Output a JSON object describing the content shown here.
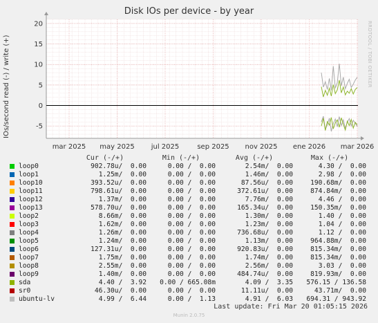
{
  "chart_data": {
    "type": "line",
    "title": "Disk IOs per device - by year",
    "ylabel": "IOs/second read (-) / write (+)",
    "ylim": [
      -8,
      21
    ],
    "y_ticks": [
      {
        "value": 20,
        "label": "20"
      },
      {
        "value": 15,
        "label": "15"
      },
      {
        "value": 10,
        "label": "10"
      },
      {
        "value": 5,
        "label": "5"
      },
      {
        "value": 0,
        "label": "0"
      },
      {
        "value": -5,
        "label": "-5"
      }
    ],
    "x_ticks": [
      "mar 2025",
      "may 2025",
      "jul 2025",
      "sep 2025",
      "nov 2025",
      "ene 2026",
      "mar 2026"
    ],
    "grid": true,
    "series": [
      {
        "name": "ubuntu-lv",
        "color": "#aaaaaa",
        "write": [
          8.0,
          4.5,
          5.8,
          3.9,
          6.6,
          3.7,
          9.6,
          4.2,
          5.6,
          10.2,
          4.8,
          6.9,
          4.1,
          5.4,
          6.4,
          4.4,
          5.2,
          6.2,
          6.9
        ],
        "read": [
          -4.0,
          -2.6,
          -5.8,
          -4.7,
          -3.1,
          -6.3,
          -4.4,
          -3.3,
          -5.2,
          -2.7,
          -4.9,
          -3.5,
          -5.6,
          -4.1,
          -3.2,
          -5.0,
          -3.6,
          -4.3,
          -5.1
        ]
      },
      {
        "name": "sda",
        "color": "#8fb62e",
        "write": [
          4.6,
          2.1,
          3.7,
          2.5,
          4.2,
          2.3,
          5.1,
          2.9,
          3.8,
          6.2,
          3.1,
          4.5,
          2.6,
          3.5,
          3.0,
          4.1,
          2.8,
          3.9,
          4.4
        ],
        "read": [
          -5.0,
          -3.1,
          -6.1,
          -3.9,
          -4.8,
          -2.9,
          -5.7,
          -4.2,
          -3.5,
          -5.3,
          -3.0,
          -4.6,
          -6.0,
          -3.8,
          -4.9,
          -3.4,
          -5.5,
          -4.1,
          -4.7
        ]
      }
    ]
  },
  "watermark": "RRDTOOL / TOBI OETIKER",
  "legend": {
    "header": {
      "cur": "Cur (-/+)",
      "min": "Min (-/+)",
      "avg": "Avg (-/+)",
      "max": "Max (-/+)"
    },
    "rows": [
      {
        "name": "loop0",
        "color": "#00cc00",
        "cur": "902.78u/  0.00",
        "min": "0.00 /  0.00",
        "avg": "2.54m/  0.00",
        "max": "4.30 /  0.00"
      },
      {
        "name": "loop1",
        "color": "#0066b3",
        "cur": "1.25m/  0.00",
        "min": "0.00 /  0.00",
        "avg": "1.46m/  0.00",
        "max": "2.98 /  0.00"
      },
      {
        "name": "loop10",
        "color": "#ff8000",
        "cur": "393.52u/  0.00",
        "min": "0.00 /  0.00",
        "avg": "87.56u/  0.00",
        "max": "190.68m/  0.00"
      },
      {
        "name": "loop11",
        "color": "#ffcc00",
        "cur": "798.61u/  0.00",
        "min": "0.00 /  0.00",
        "avg": "372.61u/  0.00",
        "max": "874.84m/  0.00"
      },
      {
        "name": "loop12",
        "color": "#330099",
        "cur": "1.37m/  0.00",
        "min": "0.00 /  0.00",
        "avg": "7.76m/  0.00",
        "max": "4.46 /  0.00"
      },
      {
        "name": "loop13",
        "color": "#990099",
        "cur": "578.70u/  0.00",
        "min": "0.00 /  0.00",
        "avg": "165.34u/  0.00",
        "max": "150.35m/  0.00"
      },
      {
        "name": "loop2",
        "color": "#ccff00",
        "cur": "8.66m/  0.00",
        "min": "0.00 /  0.00",
        "avg": "1.30m/  0.00",
        "max": "1.40 /  0.00"
      },
      {
        "name": "loop3",
        "color": "#ff0000",
        "cur": "1.62m/  0.00",
        "min": "0.00 /  0.00",
        "avg": "1.23m/  0.00",
        "max": "1.04 /  0.00"
      },
      {
        "name": "loop4",
        "color": "#808080",
        "cur": "1.26m/  0.00",
        "min": "0.00 /  0.00",
        "avg": "736.68u/  0.00",
        "max": "1.12 /  0.00"
      },
      {
        "name": "loop5",
        "color": "#008f00",
        "cur": "1.24m/  0.00",
        "min": "0.00 /  0.00",
        "avg": "1.13m/  0.00",
        "max": "964.88m/  0.00"
      },
      {
        "name": "loop6",
        "color": "#00487d",
        "cur": "127.31u/  0.00",
        "min": "0.00 /  0.00",
        "avg": "920.83u/  0.00",
        "max": "815.34m/  0.00"
      },
      {
        "name": "loop7",
        "color": "#b35a00",
        "cur": "1.75m/  0.00",
        "min": "0.00 /  0.00",
        "avg": "1.74m/  0.00",
        "max": "815.34m/  0.00"
      },
      {
        "name": "loop8",
        "color": "#b38f00",
        "cur": "2.55m/  0.00",
        "min": "0.00 /  0.00",
        "avg": "2.56m/  0.00",
        "max": "3.03 /  0.00"
      },
      {
        "name": "loop9",
        "color": "#6b006b",
        "cur": "1.40m/  0.00",
        "min": "0.00 /  0.00",
        "avg": "484.74u/  0.00",
        "max": "819.93m/  0.00"
      },
      {
        "name": "sda",
        "color": "#8fb300",
        "cur": "4.40 /  3.92",
        "min": "0.00 / 665.08m",
        "avg": "4.09 /  3.35",
        "max": "576.15 / 136.58"
      },
      {
        "name": "sr0",
        "color": "#b30000",
        "cur": "46.30u/  0.00",
        "min": "0.00 /  0.00",
        "avg": "11.11u/  0.00",
        "max": "43.71m/  0.00"
      },
      {
        "name": "ubuntu-lv",
        "color": "#bebebe",
        "cur": "4.99 /  6.44",
        "min": "0.00 /  1.13",
        "avg": "4.91 /  6.03",
        "max": "694.31 / 943.92"
      }
    ]
  },
  "last_update": "Last update: Fri Mar 20 01:05:15 2026",
  "footer": "Munin 2.0.75"
}
